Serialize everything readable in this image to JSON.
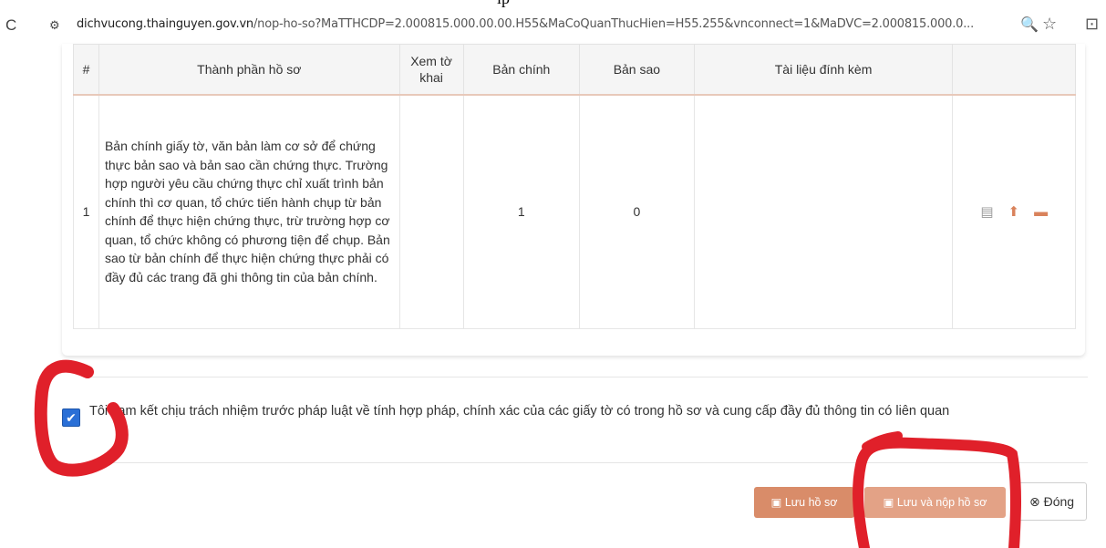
{
  "browser": {
    "url_host": "dichvucong.thainguyen.gov.vn",
    "url_path": "/nop-ho-so?MaTTHCDP=2.000815.000.00.00.H55&MaCoQuanThucHien=H55.255&vnconnect=1&MaDVC=2.000815.000.0...",
    "page_fragment": "ip"
  },
  "table": {
    "headers": [
      "#",
      "Thành phần hồ sơ",
      "Xem tờ khai",
      "Bản chính",
      "Bản sao",
      "Tài liệu đính kèm",
      ""
    ],
    "rows": [
      {
        "index": "1",
        "description": "Bản chính giấy tờ, văn bản làm cơ sở để chứng thực bản sao và bản sao cần chứng thực. Trường hợp người yêu cầu chứng thực chỉ xuất trình bản chính thì cơ quan, tổ chức tiến hành chụp từ bản chính để thực hiện chứng thực, trừ trường hợp cơ quan, tổ chức không có phương tiện để chụp. Bản sao từ bản chính để thực hiện chứng thực phải có đầy đủ các trang đã ghi thông tin của bản chính.",
        "view_form": "",
        "original_count": "1",
        "copy_count": "0",
        "attachments": ""
      }
    ]
  },
  "commitment": {
    "checked": true,
    "text": "Tôi cam kết chịu trách nhiệm trước pháp luật về tính hợp pháp, chính xác của các giấy tờ có trong hồ sơ và cung cấp đầy đủ thông tin có liên quan"
  },
  "buttons": {
    "save": "Lưu hồ sơ",
    "save_submit": "Lưu và nộp hồ sơ",
    "close": "Đóng"
  },
  "colors": {
    "primary_button": "#d98c69",
    "annotation": "#e0202a",
    "checkbox": "#2a6fd6"
  }
}
